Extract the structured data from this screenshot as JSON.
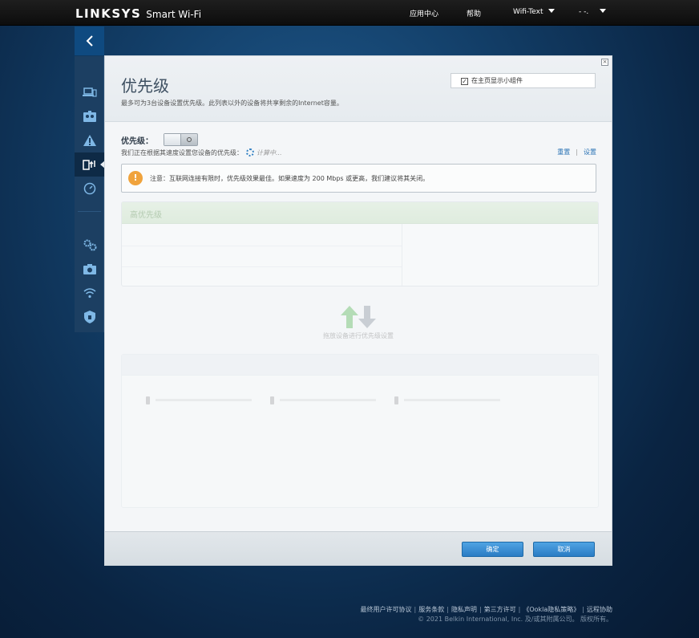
{
  "topbar": {
    "logo": "LINKSYS",
    "product": "Smart Wi-Fi",
    "nav": {
      "apps": "应用中心",
      "help": "帮助",
      "network": "Wifi-Text",
      "user": "- -."
    }
  },
  "rail": {
    "back": "‹"
  },
  "dialog": {
    "title": "优先级",
    "description": "最多可为3台设备设置优先级。此列表以外的设备将共享剩余的Internet容量。",
    "widget_checkbox": "在主页显示小组件",
    "priority_label": "优先级：",
    "speed_text": "我们正在根据其速度设置您设备的优先级：",
    "computing": "计算中...",
    "reset_link": "重置",
    "settings_link": "设置",
    "notice": "注意：互联网连接有限时，优先级效果最佳。如果速度为 200 Mbps 或更高，我们建议将其关闭。",
    "high_priority_header": "高优先级",
    "drag_hint": "拖放设备进行优先级设置",
    "ok_button": "确定",
    "cancel_button": "取消"
  },
  "footer": {
    "links": [
      "最终用户许可协议",
      "服务条款",
      "隐私声明",
      "第三方许可",
      "《Ookla隐私策略》",
      "远程协助"
    ],
    "copyright": "© 2021 Belkin International, Inc. 及/或其附属公司。 版权所有。"
  },
  "colors": {
    "accent": "#2b7cc4",
    "rail_bg": "#1c3f62",
    "high_priority_header": "#b9dbb0",
    "warning": "#f0a33c"
  }
}
